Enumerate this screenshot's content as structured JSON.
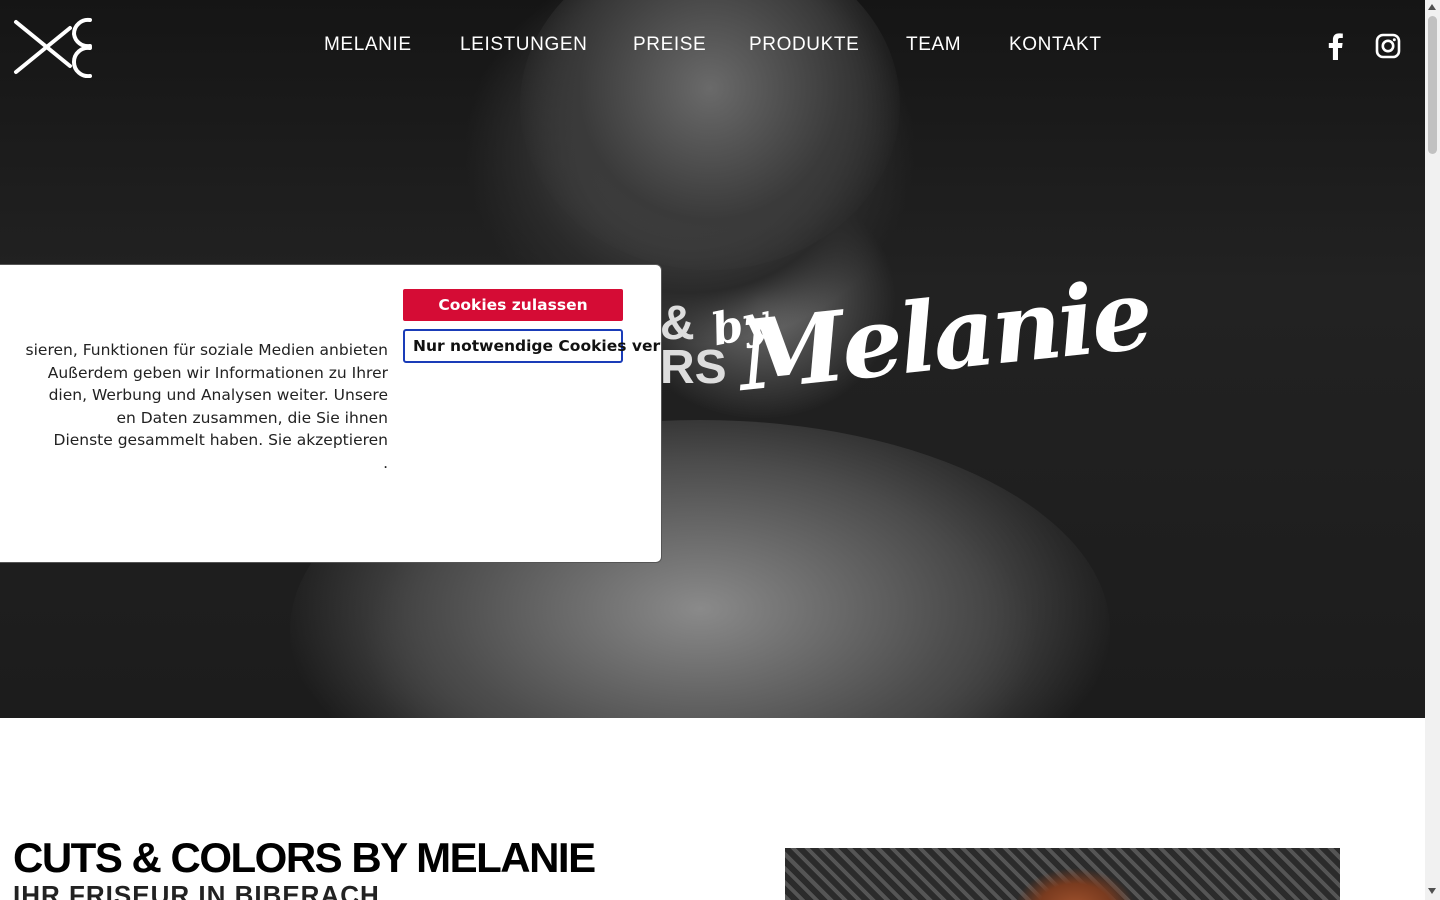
{
  "nav": {
    "items": [
      {
        "label": "MELANIE"
      },
      {
        "label": "LEISTUNGEN"
      },
      {
        "label": "PREISE"
      },
      {
        "label": "PRODUKTE"
      },
      {
        "label": "TEAM"
      },
      {
        "label": "KONTAKT"
      }
    ],
    "social": [
      "facebook-icon",
      "instagram-icon"
    ]
  },
  "hero": {
    "script_by": "by",
    "script_name": "Melanie",
    "script_amp": "&",
    "script_rs": "RS"
  },
  "cookie": {
    "text": "sieren, Funktionen für soziale Medien anbieten\n Außerdem geben wir Informationen zu Ihrer\ndien, Werbung und Analysen weiter. Unsere\nen Daten zusammen, die Sie ihnen\n Dienste gesammelt haben. Sie akzeptieren\n.",
    "allow_label": "Cookies zulassen",
    "necessary_label": "Nur notwendige Cookies verwenden"
  },
  "content": {
    "headline": "CUTS & COLORS BY MELANIE",
    "subheadline": "IHR FRISEUR IN BIBERACH"
  },
  "colors": {
    "accent": "#d50c35",
    "focus_border": "#1a3cb8"
  }
}
